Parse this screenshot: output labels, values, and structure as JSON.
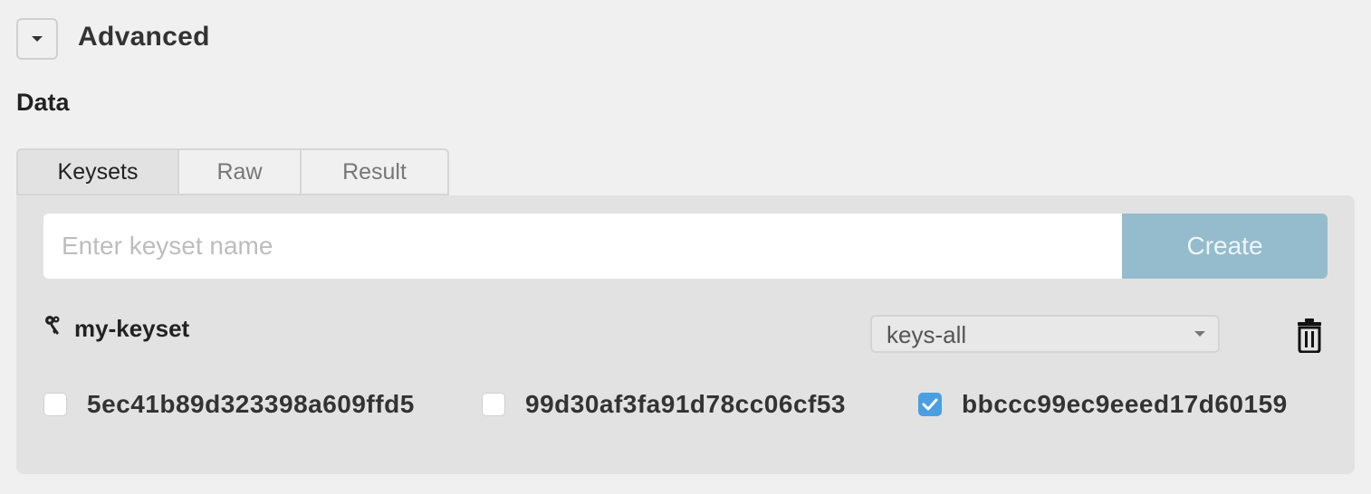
{
  "advanced": {
    "title": "Advanced",
    "toggle_icon": "caret-down-icon"
  },
  "data_section": {
    "label": "Data"
  },
  "tabs": [
    {
      "label": "Keysets",
      "active": true
    },
    {
      "label": "Raw",
      "active": false
    },
    {
      "label": "Result",
      "active": false
    }
  ],
  "keyset_form": {
    "placeholder": "Enter keyset name",
    "value": "",
    "create_label": "Create"
  },
  "keyset": {
    "name": "my-keyset",
    "icon": "key-icon",
    "predicate": {
      "selected": "keys-all"
    },
    "delete_icon": "trash-icon",
    "keys": [
      {
        "text": "5ec41b89d323398a609ffd5",
        "checked": false
      },
      {
        "text": "99d30af3fa91d78cc06cf53",
        "checked": false
      },
      {
        "text": "bbccc99ec9eeed17d60159",
        "checked": true
      }
    ]
  },
  "colors": {
    "background": "#f0f0f0",
    "panel": "#e2e2e2",
    "create_button": "#95bccd",
    "checkbox_checked": "#4a9fe0"
  }
}
